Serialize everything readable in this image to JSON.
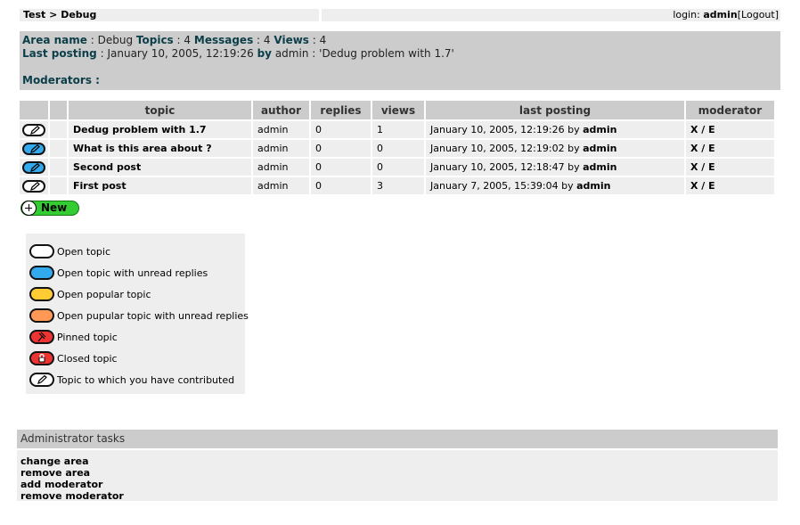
{
  "breadcrumb": {
    "root": "Test",
    "sep": ">",
    "current": "Debug"
  },
  "login": {
    "prefix": "login:",
    "user": "admin",
    "logout": "[Logout]"
  },
  "area": {
    "name_label": "Area name",
    "name_value": "Debug",
    "topics_label": "Topics",
    "topics_value": "4",
    "messages_label": "Messages",
    "messages_value": "4",
    "views_label": "Views",
    "views_value": "4",
    "last_label": "Last posting",
    "last_date": "January 10, 2005, 12:19:26",
    "last_by": "by",
    "last_user": "admin",
    "last_topic": "'Dedug problem with 1.7'",
    "moderators_label": "Moderators :"
  },
  "table": {
    "headers": [
      "topic",
      "author",
      "replies",
      "views",
      "last posting",
      "moderator"
    ],
    "rows": [
      {
        "icon": "open-contributed-icon",
        "title": "Dedug problem with 1.7",
        "author": "admin",
        "replies": "0",
        "views": "1",
        "date": "January 10, 2005, 12:19:26",
        "by": "by",
        "user": "admin",
        "mod": "X / E"
      },
      {
        "icon": "unread-contributed-icon",
        "title": "What is this area about ?",
        "author": "admin",
        "replies": "0",
        "views": "0",
        "date": "January 10, 2005, 12:19:02",
        "by": "by",
        "user": "admin",
        "mod": "X / E"
      },
      {
        "icon": "unread-contributed-icon",
        "title": "Second post",
        "author": "admin",
        "replies": "0",
        "views": "0",
        "date": "January 10, 2005, 12:18:47",
        "by": "by",
        "user": "admin",
        "mod": "X / E"
      },
      {
        "icon": "open-contributed-icon",
        "title": "First post",
        "author": "admin",
        "replies": "0",
        "views": "3",
        "date": "January 7, 2005, 15:39:04",
        "by": "by",
        "user": "admin",
        "mod": "X / E"
      }
    ]
  },
  "new_button": "New",
  "legend": [
    {
      "icon": "open-topic-icon",
      "label": "Open topic"
    },
    {
      "icon": "unread-topic-icon",
      "label": "Open topic with unread replies"
    },
    {
      "icon": "popular-topic-icon",
      "label": "Open popular topic"
    },
    {
      "icon": "popular-unread-topic-icon",
      "label": "Open pupular topic with unread replies"
    },
    {
      "icon": "pinned-topic-icon",
      "label": "Pinned topic"
    },
    {
      "icon": "closed-topic-icon",
      "label": "Closed topic"
    },
    {
      "icon": "contributed-topic-icon",
      "label": "Topic to which you have contributed"
    }
  ],
  "colors": {
    "unread": "#33aaee",
    "popular": "#ffcc33",
    "popular_unread": "#ff9955",
    "pinned": "#ee3333",
    "new_button": "#33cc33"
  },
  "admin": {
    "title": "Administrator tasks",
    "tasks": [
      "change area",
      "remove area",
      "add moderator",
      "remove moderator"
    ]
  }
}
